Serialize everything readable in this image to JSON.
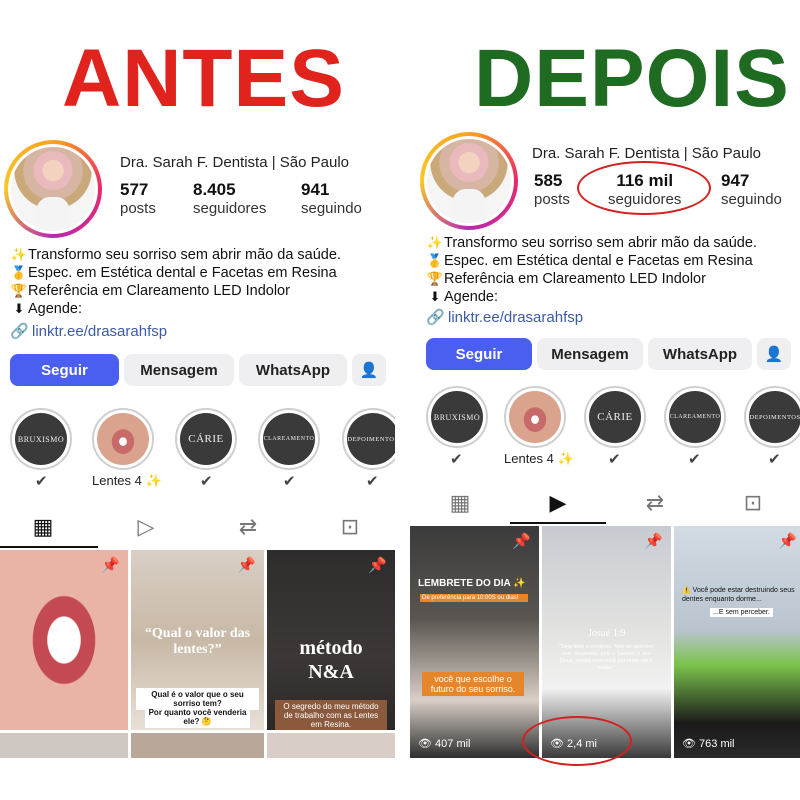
{
  "titles": {
    "left": "ANTES",
    "right": "DEPOIS"
  },
  "before": {
    "name": "Dra. Sarah F. Dentista  | São Paulo",
    "stats": [
      {
        "num": "577",
        "label": "posts"
      },
      {
        "num": "8.405",
        "label": "seguidores"
      },
      {
        "num": "941",
        "label": "seguindo"
      }
    ],
    "bio": [
      {
        "icon": "✨",
        "text": "Transformo seu sorriso sem abrir mão da saúde."
      },
      {
        "icon": "🥇",
        "text": "Espec. em Estética dental e Facetas em Resina"
      },
      {
        "icon": "🏆",
        "text": "Referência em Clareamento LED Indolor"
      },
      {
        "icon": "⬇",
        "text": "Agende:"
      }
    ],
    "link": "linktr.ee/drasarahfsp",
    "buttons": {
      "follow": "Seguir",
      "message": "Mensagem",
      "whatsapp": "WhatsApp"
    },
    "highlights": [
      {
        "label": "",
        "title": "BRUXISMO"
      },
      {
        "label": "Lentes 4 ✨",
        "title": ""
      },
      {
        "label": "",
        "title": "CÁRIE"
      },
      {
        "label": "",
        "title": "CLAREAMENTO"
      },
      {
        "label": "",
        "title": "DEPOIMENTOS"
      }
    ],
    "tiles": {
      "t2_title": "“Qual o valor das lentes?”",
      "t2_caption1": "Qual é o valor que o seu sorriso tem?",
      "t2_caption2": "Por quanto você venderia ele? 🤔",
      "t3_title": "método N&A",
      "t3_caption": "O segredo do meu método de trabalho com as Lentes em Resina."
    }
  },
  "after": {
    "name": "Dra. Sarah F. Dentista  | São Paulo",
    "stats": [
      {
        "num": "585",
        "label": "posts"
      },
      {
        "num": "116 mil",
        "label": "seguidores"
      },
      {
        "num": "947",
        "label": "seguindo"
      }
    ],
    "bio": [
      {
        "icon": "✨",
        "text": "Transformo seu sorriso sem abrir mão da saúde."
      },
      {
        "icon": "🥇",
        "text": "Espec. em Estética dental e Facetas em Resina"
      },
      {
        "icon": "🏆",
        "text": "Referência em Clareamento LED Indolor"
      },
      {
        "icon": "⬇",
        "text": "Agende:"
      }
    ],
    "link": "linktr.ee/drasarahfsp",
    "buttons": {
      "follow": "Seguir",
      "message": "Mensagem",
      "whatsapp": "WhatsApp"
    },
    "highlights": [
      {
        "label": "",
        "title": "BRUXISMO"
      },
      {
        "label": "Lentes 4 ✨",
        "title": ""
      },
      {
        "label": "",
        "title": "CÁRIE"
      },
      {
        "label": "",
        "title": "CLAREAMENTO"
      },
      {
        "label": "",
        "title": "DEPOIMENTOS"
      }
    ],
    "tiles": {
      "t1_title": "LEMBRETE DO DIA ✨",
      "t1_sub": "De preferência para 10:00S ou dias!",
      "t1_caption": "você que escolhe o futuro do seu sorriso.",
      "t1_views": "407 mil",
      "t2_title": "Josué 1:9",
      "t2_caption": "\"Seja forte e corajoso. Não se apavore nem desanime, pois o Senhor, o seu Deus, estará com você por onde você andar.\"",
      "t2_views": "2,4 mi",
      "t3_title": "⚠️ Você pode estar destruindo seus dentes enquanto dorme...",
      "t3_sub": "...E sem perceber.",
      "t3_views": "763 mil"
    }
  },
  "colors": {
    "antes": "#e0231d",
    "depois": "#1f6b21",
    "follow": "#4a5ff0",
    "highlight_ellipse": "#d42020"
  }
}
